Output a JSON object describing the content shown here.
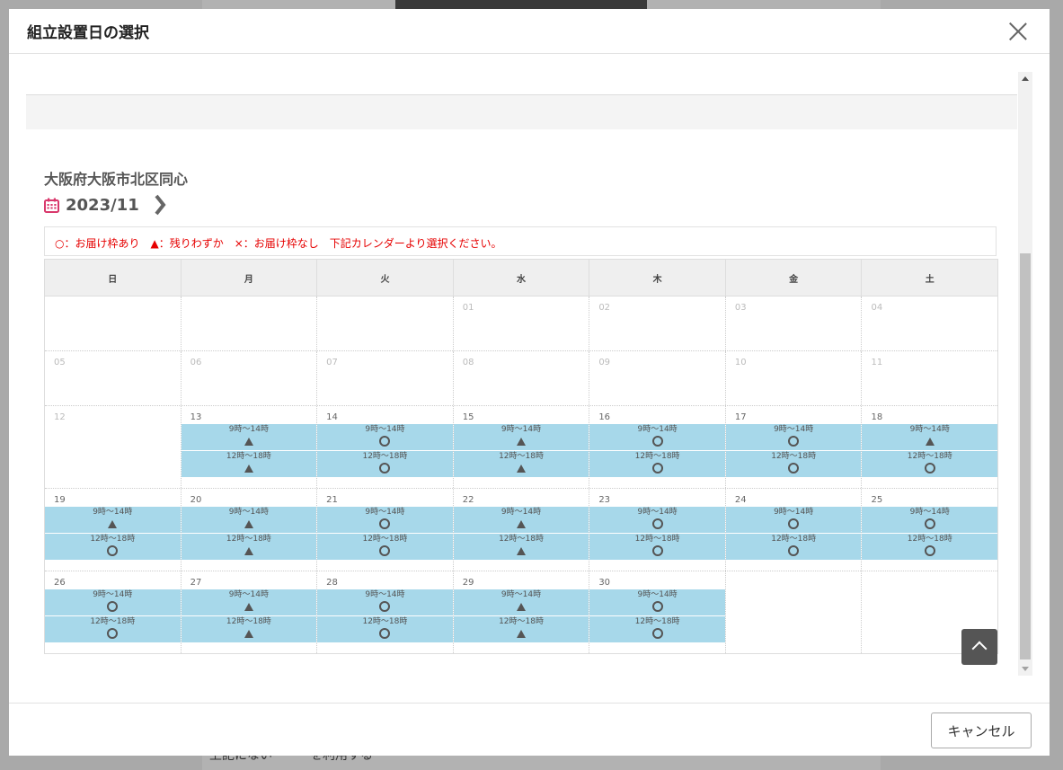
{
  "modal": {
    "title": "組立設置日の選択",
    "address": "大阪府大阪市北区同心",
    "month": "2023/11",
    "legend": "○：お届け枠あり　▲：残りわずか　×：お届け枠なし　下記カレンダーより選択ください。",
    "cancel_label": "キャンセル",
    "background_text": "上記にない・・・を利用する"
  },
  "calendar": {
    "weekdays": [
      "日",
      "月",
      "火",
      "水",
      "木",
      "金",
      "土"
    ],
    "slot_labels": [
      "9時～14時",
      "12時～18時"
    ],
    "weeks": [
      [
        {
          "day": ""
        },
        {
          "day": ""
        },
        {
          "day": ""
        },
        {
          "day": "01"
        },
        {
          "day": "02"
        },
        {
          "day": "03"
        },
        {
          "day": "04"
        }
      ],
      [
        {
          "day": "05"
        },
        {
          "day": "06"
        },
        {
          "day": "07"
        },
        {
          "day": "08"
        },
        {
          "day": "09"
        },
        {
          "day": "10"
        },
        {
          "day": "11"
        }
      ],
      [
        {
          "day": "12"
        },
        {
          "day": "13",
          "slots": [
            "▲",
            "▲"
          ]
        },
        {
          "day": "14",
          "slots": [
            "○",
            "○"
          ]
        },
        {
          "day": "15",
          "slots": [
            "▲",
            "▲"
          ]
        },
        {
          "day": "16",
          "slots": [
            "○",
            "○"
          ]
        },
        {
          "day": "17",
          "slots": [
            "○",
            "○"
          ]
        },
        {
          "day": "18",
          "slots": [
            "▲",
            "○"
          ]
        }
      ],
      [
        {
          "day": "19",
          "slots": [
            "▲",
            "○"
          ]
        },
        {
          "day": "20",
          "slots": [
            "▲",
            "▲"
          ]
        },
        {
          "day": "21",
          "slots": [
            "○",
            "○"
          ]
        },
        {
          "day": "22",
          "slots": [
            "▲",
            "▲"
          ]
        },
        {
          "day": "23",
          "slots": [
            "○",
            "○"
          ]
        },
        {
          "day": "24",
          "slots": [
            "○",
            "○"
          ]
        },
        {
          "day": "25",
          "slots": [
            "○",
            "○"
          ]
        }
      ],
      [
        {
          "day": "26",
          "slots": [
            "○",
            "○"
          ]
        },
        {
          "day": "27",
          "slots": [
            "▲",
            "▲"
          ]
        },
        {
          "day": "28",
          "slots": [
            "○",
            "○"
          ]
        },
        {
          "day": "29",
          "slots": [
            "▲",
            "▲"
          ]
        },
        {
          "day": "30",
          "slots": [
            "○",
            "○"
          ]
        },
        {
          "day": ""
        },
        {
          "day": ""
        }
      ]
    ]
  },
  "colors": {
    "slot_bg": "#a7d8ea",
    "legend_text": "#e60000",
    "calendar_icon": "#d9386c"
  }
}
